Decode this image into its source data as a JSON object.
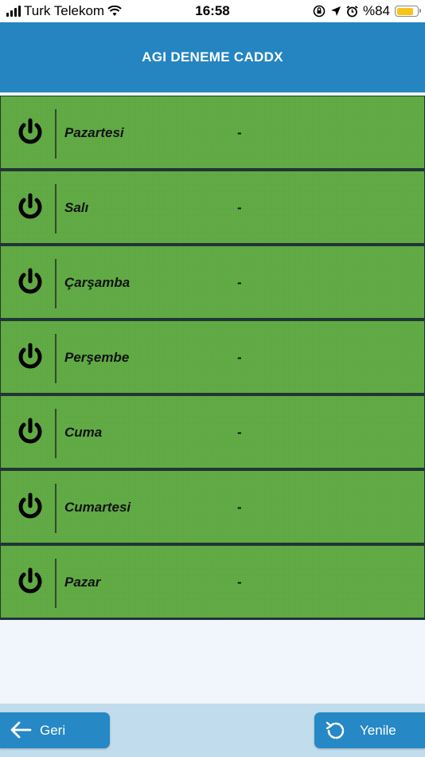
{
  "status_bar": {
    "carrier": "Turk Telekom",
    "time": "16:58",
    "battery_percent": "%84",
    "battery_level": 0.84,
    "battery_color": "#f5c518",
    "icons": [
      "signal-icon",
      "wifi-icon",
      "screen-lock-icon",
      "location-icon",
      "alarm-icon",
      "battery-icon"
    ]
  },
  "header": {
    "title": "AGI DENEME CADDX"
  },
  "days": [
    {
      "name": "Pazartesi",
      "value": "-"
    },
    {
      "name": "Salı",
      "value": "-"
    },
    {
      "name": "Çarşamba",
      "value": "-"
    },
    {
      "name": "Perşembe",
      "value": "-"
    },
    {
      "name": "Cuma",
      "value": "-"
    },
    {
      "name": "Cumartesi",
      "value": "-"
    },
    {
      "name": "Pazar",
      "value": "-"
    }
  ],
  "footer": {
    "back_label": "Geri",
    "refresh_label": "Yenile"
  },
  "colors": {
    "header": "#2485c1",
    "row": "#62ad46",
    "button": "#2688c4",
    "footer": "#c1dced"
  }
}
